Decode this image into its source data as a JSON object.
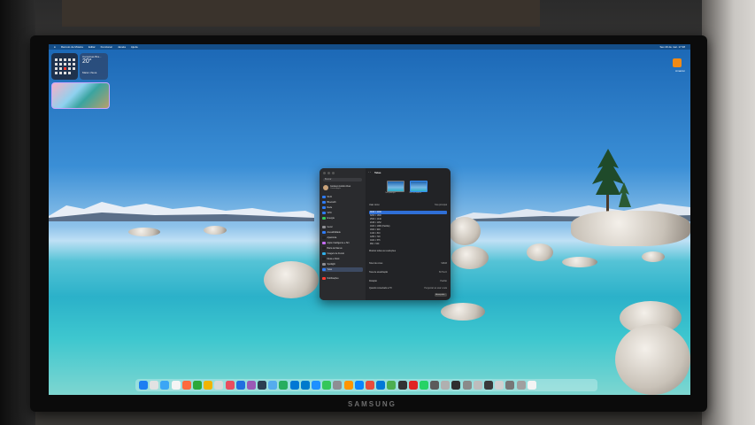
{
  "monitor": {
    "brand": "SAMSUNG"
  },
  "menubar": {
    "items": [
      "Remoto de Música",
      "Editar",
      "Funcionar",
      "Janela",
      "Ajuda"
    ],
    "clock": "Sex 20 de mar. 17:38"
  },
  "widgets": {
    "weather": {
      "city": "Campinas Bra...",
      "temp": "20°",
      "condition": "Maior chuva"
    },
    "shopping_label": "Amazon"
  },
  "settings": {
    "search_placeholder": "Buscar",
    "account_name": "Gustavo Aurélio Alves",
    "account_sub": "Conta Apple",
    "sidebar": [
      "Wi-Fi",
      "Bluetooth",
      "Rede",
      "VPN",
      "Energia",
      "Geral",
      "Acessibilidade",
      "Aparência",
      "Apple Intelligence e Siri",
      "Barra de Menus",
      "Imagem de Fundo",
      "Mesa e Dock",
      "Spotlight",
      "Telas",
      "Notificações"
    ],
    "selected": "Telas",
    "title": "Telas",
    "arrange_left": "Tela principal",
    "arrange_right": "Tela secundária",
    "use_as_label": "Usar como",
    "use_as_value": "Tela principal",
    "resolutions": [
      "3840 × 2160",
      "3200 × 1800",
      "2560 × 1440",
      "2048 × 1152",
      "1920 × 1080 (Padrão)",
      "1600 × 900",
      "1440 × 810",
      "1280 × 720",
      "1024 × 576",
      "960 × 540"
    ],
    "selected_resolution": "3840 × 2160",
    "show_all": "Mostrar todas as resoluções",
    "rows": [
      {
        "label": "Nível de cores",
        "value": "SRGB"
      },
      {
        "label": "Taxa de atualização",
        "value": "60 Hertz"
      },
      {
        "label": "Rotação",
        "value": "Padrão"
      },
      {
        "label": "Quando conectado a TV",
        "value": "Perguntar ao usar a tela"
      }
    ],
    "advanced_button": "Avançado..."
  },
  "dock": {
    "icon_colors": [
      "#1c7ef2",
      "#e2e2e2",
      "#3ba6f5",
      "#f5f5f5",
      "#ff6b3d",
      "#2ca83a",
      "#f0b400",
      "#d8d8d8",
      "#e94d5f",
      "#1f6fe0",
      "#9b59b6",
      "#2c3e50",
      "#55acee",
      "#27ae60",
      "#0078d4",
      "#007acc",
      "#1e90ff",
      "#34c759",
      "#8e8e93",
      "#ff9500",
      "#0a84ff",
      "#e74c3c",
      "#0078d7",
      "#4caf50",
      "#333333",
      "#e02424",
      "#25d366",
      "#5b5b5b",
      "#b0b0b0",
      "#2f2f2f",
      "#8a8a8a",
      "#bdbdbd",
      "#3a3a3a",
      "#d0d0d0",
      "#777777",
      "#a0a0a0",
      "#f4f4f4"
    ]
  }
}
